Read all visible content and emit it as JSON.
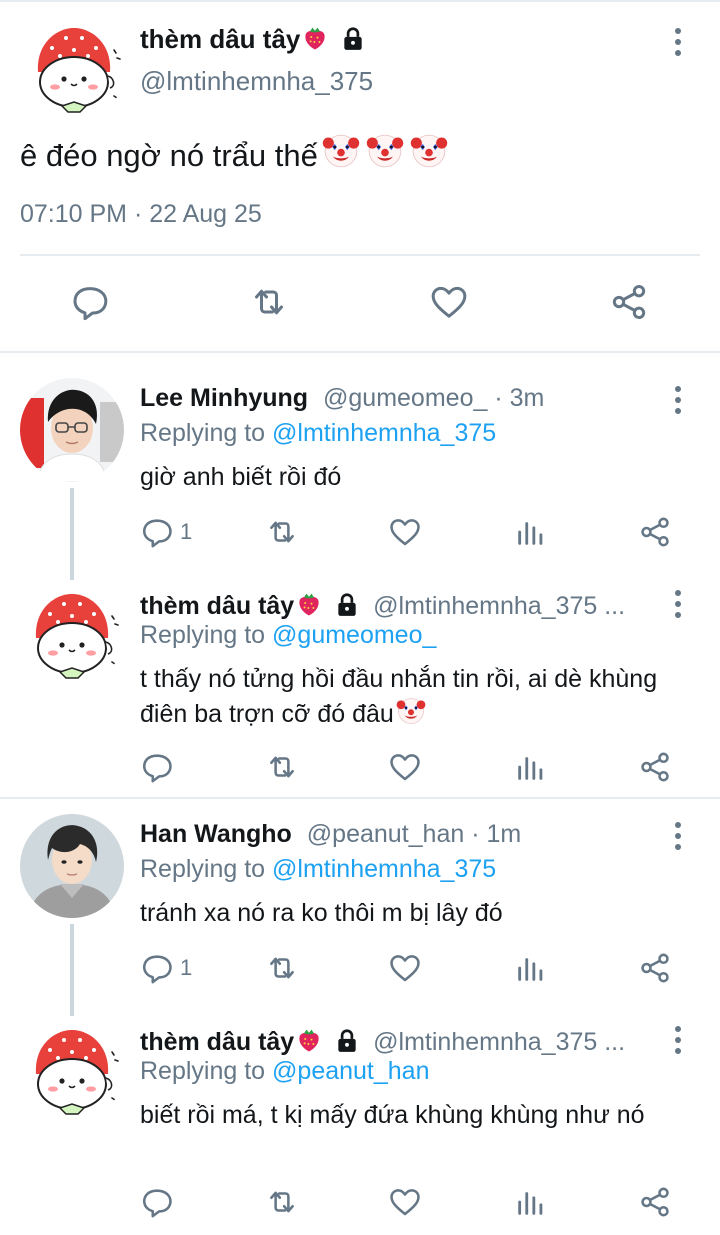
{
  "main_tweet": {
    "author_name": "thèm dâu tây",
    "author_handle": "@lmtinhemnha_375",
    "text": "ê đéo ngờ nó trẩu thế",
    "timestamp": "07:10 PM · 22 Aug 25",
    "actions": [
      "reply-icon",
      "retweet-icon",
      "like-icon",
      "share-icon"
    ]
  },
  "replies": [
    {
      "author_name": "Lee Minhyung",
      "handle_time": "@gumeomeo_ · 3m",
      "replying_prefix": "Replying to ",
      "replying_to": "@lmtinhemnha_375",
      "text": "giờ anh biết rồi đó",
      "reply_count": "1"
    },
    {
      "author_name": "thèm dâu tây",
      "handle_time": "@lmtinhemnha_375 ...",
      "replying_prefix": "Replying to ",
      "replying_to": "@gumeomeo_",
      "text": "t thấy nó tửng hồi đầu nhắn tin rồi, ai dè khùng điên ba trợn cỡ đó đâu",
      "reply_count": ""
    },
    {
      "author_name": "Han Wangho",
      "handle_time": "@peanut_han · 1m",
      "replying_prefix": "Replying to ",
      "replying_to": "@lmtinhemnha_375",
      "text": "tránh xa nó ra ko thôi m bị lây đó",
      "reply_count": "1"
    },
    {
      "author_name": "thèm dâu tây",
      "handle_time": "@lmtinhemnha_375 ...",
      "replying_prefix": "Replying to ",
      "replying_to": "@peanut_han",
      "text": "biết rồi má, t kị mấy đứa khùng khùng như nó",
      "reply_count": ""
    }
  ],
  "colors": {
    "link": "#1da1f2",
    "secondary_text": "#657786",
    "divider": "#e6ecf0"
  }
}
